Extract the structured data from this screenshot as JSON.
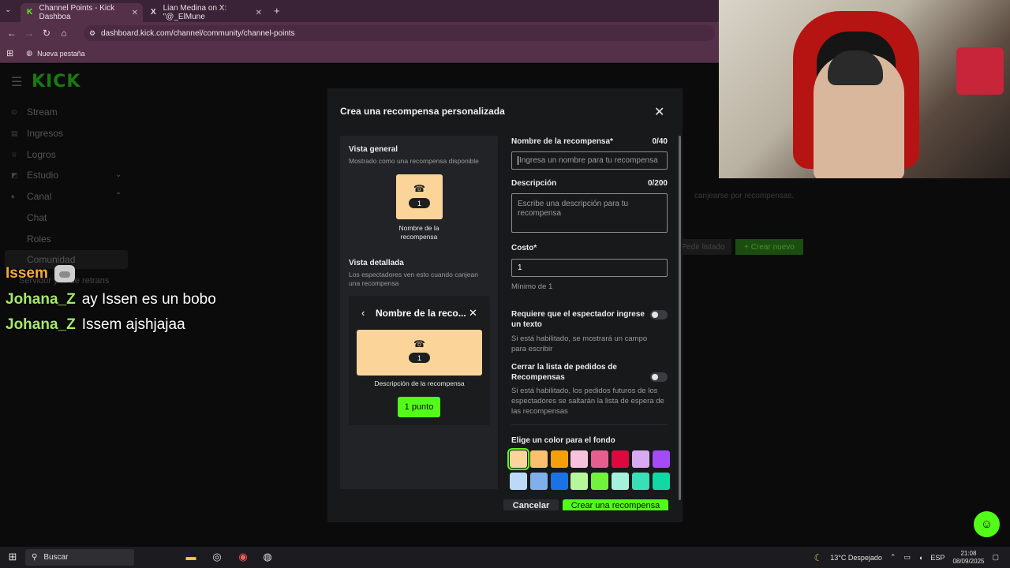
{
  "browser": {
    "tabs": [
      {
        "label": "Channel Points - Kick Dashboa",
        "favicon": "K"
      },
      {
        "label": "Lian Medina on X: \"@_ElMune",
        "favicon": "X"
      }
    ],
    "url": "dashboard.kick.com/channel/community/channel-points",
    "bookmark": "Nueva pestaña"
  },
  "sidebar": {
    "logo": "KICK",
    "items": [
      {
        "label": "Stream",
        "icon": "⊙"
      },
      {
        "label": "Ingresos",
        "icon": "▤"
      },
      {
        "label": "Logros",
        "icon": "♕"
      },
      {
        "label": "Estudio",
        "icon": "◩"
      },
      {
        "label": "Canal",
        "icon": "♦"
      }
    ],
    "sub_items": [
      "Chat",
      "Roles",
      "Comunidad"
    ],
    "partial": "Servidor y ... de retrans"
  },
  "chat": [
    {
      "user": "Issem",
      "message": ""
    },
    {
      "user": "Johana_Z",
      "message": "ay Issen es un bobo"
    },
    {
      "user": "Johana_Z",
      "message": "Issem ajshjajaa"
    }
  ],
  "background_page": {
    "text": "canjearse por recompensas.",
    "edit_list": "Pedir listado",
    "create_new": "+ Crear nuevo"
  },
  "modal": {
    "title": "Crea una recompensa personalizada",
    "overview_title": "Vista general",
    "overview_sub": "Mostrado como una recompensa disponible",
    "reward_cost_badge": "1",
    "reward_name_placeholder": "Nombre de la recompensa",
    "detail_title": "Vista detallada",
    "detail_sub": "Los espectadores ven esto cuando canjean una recompensa",
    "detail_header": "Nombre de la reco...",
    "detail_description": "Descripción de la recompensa",
    "points_button": "1 punto",
    "name_label": "Nombre de la recompensa*",
    "name_counter": "0/40",
    "name_placeholder": "Ingresa un nombre para tu recompensa",
    "desc_label": "Descripción",
    "desc_counter": "0/200",
    "desc_placeholder": "Escribe una descripción para tu recompensa",
    "cost_label": "Costo*",
    "cost_value": "1",
    "cost_min": "Mínimo de 1",
    "require_text_label": "Requiere que el espectador ingrese un texto",
    "require_text_help": "Si está habilitado, se mostrará un campo para escribir",
    "close_list_label": "Cerrar la lista de pedidos de Recompensas",
    "close_list_help": "Si está habilitado, los pedidos futuros de los espectadores se saltarán la lista de espera de las recompensas",
    "color_label": "Elige un color para el fondo",
    "colors_row1": [
      "#fbd49a",
      "#f9c06e",
      "#f5a00a",
      "#f7c3dc",
      "#e55f8e",
      "#dc0a3c",
      "#d8aaf2",
      "#a44bf5"
    ],
    "colors_row2": [
      "#bcd9f7",
      "#7fb0eb",
      "#1b72e6",
      "#b6f79a",
      "#71f33e",
      "#a5f2dc",
      "#38dfb7",
      "#12d8a5"
    ],
    "cancel": "Cancelar",
    "create": "Crear una recompensa"
  },
  "taskbar": {
    "search": "Buscar",
    "weather": "13°C  Despejado",
    "lang": "ESP",
    "time": "21:08",
    "date": "08/09/2025"
  }
}
